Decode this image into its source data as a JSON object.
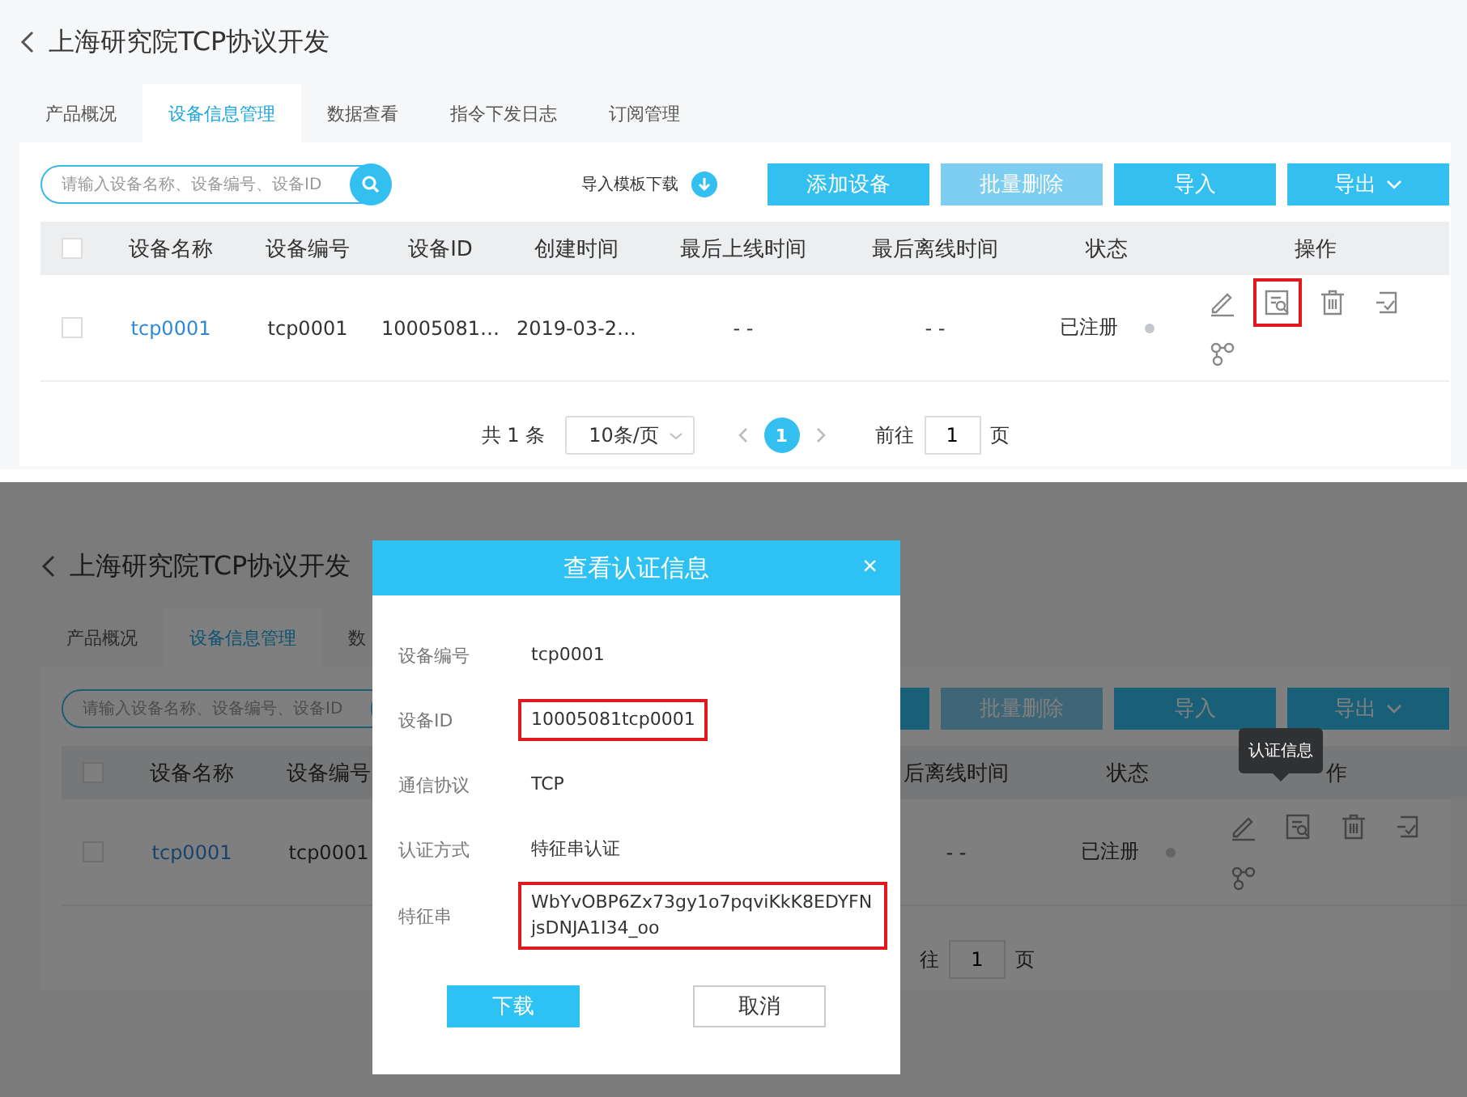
{
  "screens": [
    {
      "title": "上海研究院TCP协议开发",
      "tabs": [
        {
          "label": "产品概况",
          "selected": false
        },
        {
          "label": "设备信息管理",
          "selected": true
        },
        {
          "label": "数据查看",
          "selected": false
        },
        {
          "label": "指令下发日志",
          "selected": false
        },
        {
          "label": "订阅管理",
          "selected": false
        }
      ],
      "search": {
        "placeholder": "请输入设备名称、设备编号、设备ID"
      },
      "template_link": "导入模板下载",
      "buttons": [
        {
          "label": "添加设备",
          "disabled": false
        },
        {
          "label": "批量删除",
          "disabled": true
        },
        {
          "label": "导入",
          "disabled": false
        },
        {
          "label": "导出",
          "disabled": false,
          "kind": "dropdown"
        }
      ],
      "table": {
        "header_checked": false,
        "columns": [
          {
            "label": "设备名称"
          },
          {
            "label": "设备编号"
          },
          {
            "label": "设备ID"
          },
          {
            "label": "创建时间"
          },
          {
            "label": "最后上线时间"
          },
          {
            "label": "最后离线时间"
          },
          {
            "label": "状态"
          },
          {
            "label": "操作"
          }
        ],
        "rows": [
          {
            "checked": false,
            "cells": [
              {
                "text": "tcp0001",
                "kind": "link"
              },
              {
                "text": "tcp0001"
              },
              {
                "text": "10005081…"
              },
              {
                "text": "2019-03-2…"
              },
              {
                "text": "- -"
              },
              {
                "text": "- -"
              }
            ],
            "status": "已注册",
            "actions": [
              {
                "kind": "edit",
                "highlighted": false
              },
              {
                "kind": "view",
                "highlighted": true
              },
              {
                "kind": "delete",
                "highlighted": false
              },
              {
                "kind": "log",
                "highlighted": false
              },
              {
                "kind": "topology",
                "highlighted": false
              }
            ]
          }
        ]
      },
      "pagination": {
        "total": "共 1 条",
        "page_size": "10条/页",
        "pages": [
          {
            "label": "1",
            "selected": true
          }
        ],
        "goto_label": "前往",
        "goto_value": "1",
        "goto_unit": "页"
      }
    },
    {
      "title": "上海研究院TCP协议开发",
      "tabs": [
        {
          "label": "产品概况",
          "selected": false
        },
        {
          "label": "设备信息管理",
          "selected": true
        },
        {
          "label": "数",
          "selected": false
        }
      ],
      "search": {
        "placeholder": "请输入设备名称、设备编号、设备ID"
      },
      "buttons": [
        {
          "disabled": false
        },
        {
          "label": "批量删除",
          "disabled": true
        },
        {
          "label": "导入",
          "disabled": false
        },
        {
          "label": "导出",
          "disabled": false,
          "kind": "dropdown"
        }
      ],
      "table": {
        "header_checked": false,
        "columns": [
          {
            "label": "设备名称"
          },
          {
            "label": "设备编号"
          },
          {},
          {},
          {},
          {
            "label": "后离线时间"
          },
          {
            "label": "状态"
          },
          {
            "label": "作"
          }
        ],
        "rows": [
          {
            "checked": false,
            "cells": [
              {
                "text": "tcp0001",
                "kind": "link"
              },
              {
                "text": "tcp0001"
              },
              {},
              {},
              {},
              {
                "text": "- -"
              }
            ],
            "status": "已注册",
            "actions": [
              {
                "kind": "edit",
                "highlighted": false
              },
              {
                "kind": "view",
                "highlighted": false
              },
              {
                "kind": "delete",
                "highlighted": false
              },
              {
                "kind": "log",
                "highlighted": false
              },
              {
                "kind": "topology",
                "highlighted": false
              }
            ]
          }
        ]
      },
      "pagination": {
        "goto_label": "往",
        "goto_value": "1",
        "goto_unit": "页"
      },
      "tooltip": "认证信息",
      "dialog": {
        "title": "查看认证信息",
        "close": "×",
        "fields": [
          {
            "label": "设备编号",
            "value": "tcp0001",
            "highlighted": false
          },
          {
            "label": "设备ID",
            "value": "10005081tcp0001",
            "highlighted": true
          },
          {
            "label": "通信协议",
            "value": "TCP",
            "highlighted": false
          },
          {
            "label": "认证方式",
            "value": "特征串认证",
            "highlighted": false
          },
          {
            "label": "特征串",
            "value": "WbYvOBP6Zx73gy1o7pqviKkK8EDYFNjsDNJA1I34_oo",
            "highlighted": true
          }
        ],
        "buttons": [
          {
            "label": "下载",
            "kind": "primary"
          },
          {
            "label": "取消",
            "kind": "secondary"
          }
        ]
      }
    }
  ]
}
